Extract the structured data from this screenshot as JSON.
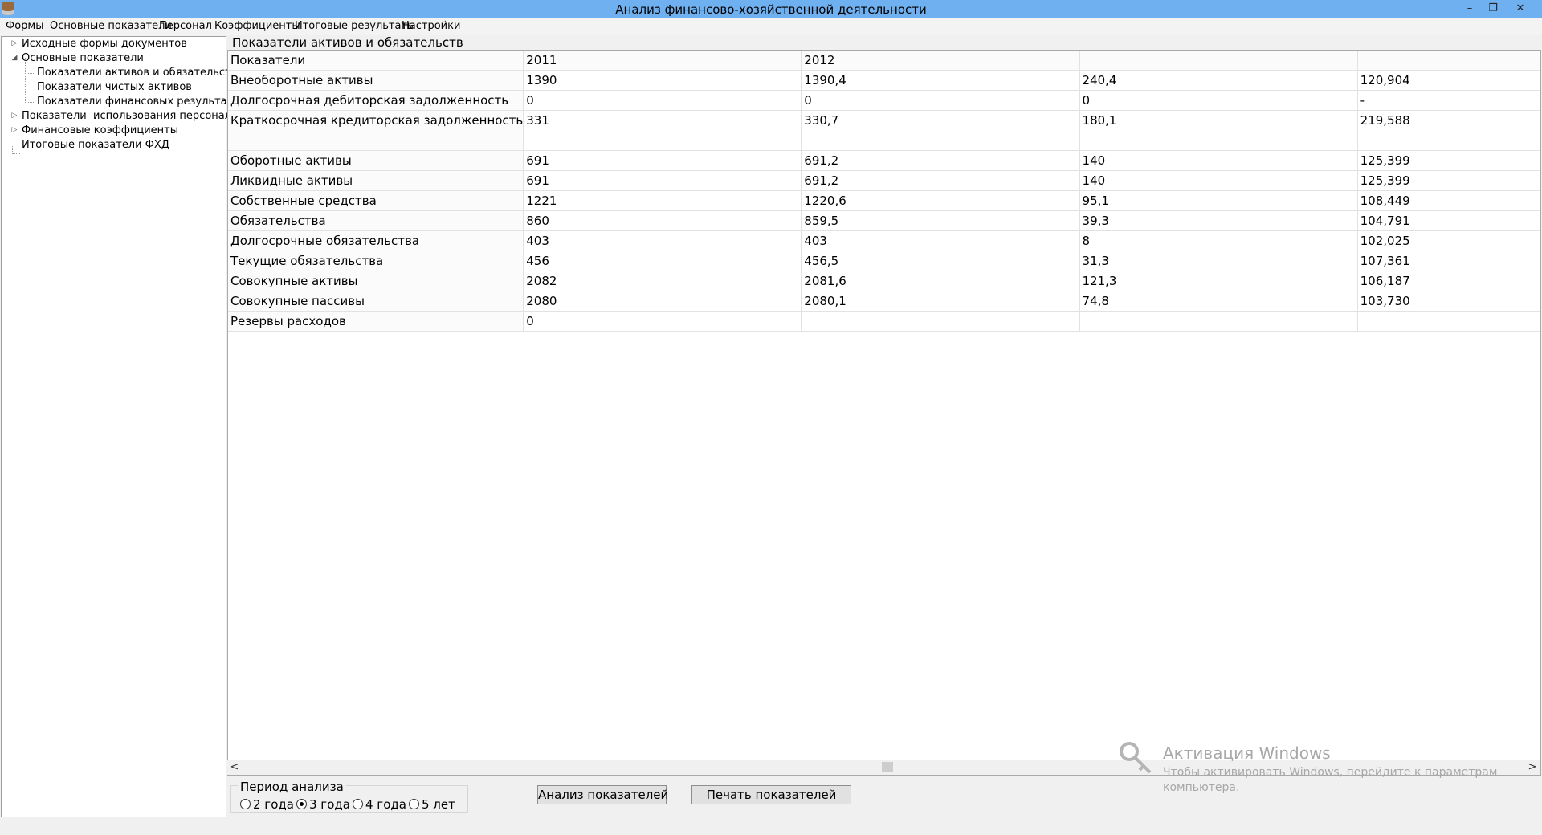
{
  "window": {
    "title": "Анализ финансово-хозяйственной деятельности",
    "min": "–",
    "restore": "❐",
    "close": "✕"
  },
  "menu": [
    "Формы",
    "Основные показатели",
    "Персонал",
    "Коэффициенты",
    "Итоговые результаты",
    "Настройки"
  ],
  "tree": {
    "items": [
      "Исходные формы документов",
      "Основные показатели",
      "Показатели активов и обязательств",
      "Показатели чистых активов",
      "Показатели финансовых результатов",
      "Показатели  использования персонала",
      "Финансовые коэффициенты",
      "Итоговые показатели ФХД"
    ]
  },
  "panel": {
    "caption": "Показатели активов и обязательств"
  },
  "table": {
    "header": [
      "Показатели",
      "2011",
      "2012",
      "",
      ""
    ],
    "rows": [
      [
        "Внеоборотные активы",
        "1390",
        "1390,4",
        "240,4",
        "120,904"
      ],
      [
        "Долгосрочная дебиторская задолженность",
        "0",
        "0",
        "0",
        "-"
      ],
      [
        "Краткосрочная кредиторская задолженность",
        "331",
        "330,7",
        "180,1",
        "219,588"
      ],
      [
        "Оборотные активы",
        "691",
        "691,2",
        "140",
        "125,399"
      ],
      [
        "Ликвидные активы",
        "691",
        "691,2",
        "140",
        "125,399"
      ],
      [
        "Собственные средства",
        "1221",
        "1220,6",
        "95,1",
        "108,449"
      ],
      [
        "Обязательства",
        "860",
        "859,5",
        "39,3",
        "104,791"
      ],
      [
        "Долгосрочные обязательства",
        "403",
        "403",
        "8",
        "102,025"
      ],
      [
        "Текущие обязательства",
        "456",
        "456,5",
        "31,3",
        "107,361"
      ],
      [
        "Совокупные активы",
        "2082",
        "2081,6",
        "121,3",
        "106,187"
      ],
      [
        "Совокупные пассивы",
        "2080",
        "2080,1",
        "74,8",
        "103,730"
      ],
      [
        "Резервы расходов",
        "0",
        "",
        "",
        ""
      ]
    ]
  },
  "scroll": {
    "left": "<",
    "right": ">"
  },
  "period": {
    "legend": "Период анализа",
    "options": [
      "2 года",
      "3 года",
      "4 года",
      "5 лет"
    ],
    "selected": "3 года"
  },
  "buttons": {
    "analyze": "Анализ показателей",
    "print": "Печать показателей"
  },
  "watermark": {
    "title": "Активация Windows",
    "subtitle": "Чтобы активировать Windows, перейдите к параметрам компьютера."
  }
}
